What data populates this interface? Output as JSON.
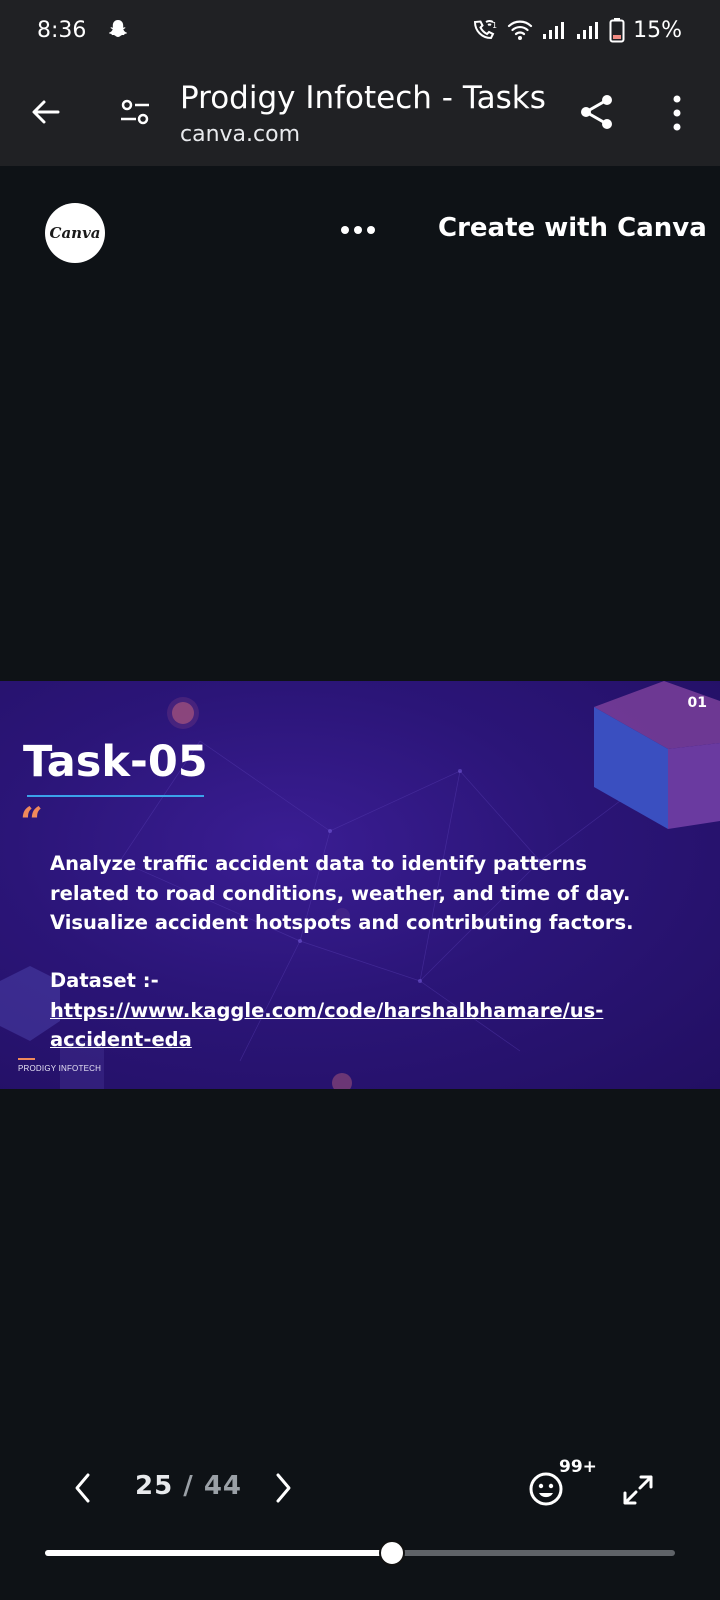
{
  "status_bar": {
    "time": "8:36",
    "battery": "15%",
    "icons": [
      "snapchat-icon",
      "wifi-call-icon",
      "wifi-icon",
      "signal-icon",
      "signal-icon",
      "battery-icon"
    ]
  },
  "app_bar": {
    "title": "Prodigy Infotech - Tasks",
    "url": "canva.com",
    "icons": [
      "back-arrow-icon",
      "tune-icon",
      "share-icon",
      "more-vert-icon"
    ]
  },
  "canva_header": {
    "logo_text": "Canva",
    "create_label": "Create with Canva"
  },
  "slide": {
    "number": "01",
    "title": "Task-05",
    "quote_mark": "“",
    "body": "Analyze traffic accident data to identify patterns related to road conditions, weather, and time of day. Visualize accident hotspots and contributing factors.",
    "dataset_label": "Dataset :-",
    "dataset_link": "https://www.kaggle.com/code/harshalbhamare/us-accident-eda",
    "brand": "PRODIGY INFOTECH",
    "colors": {
      "accent": "#f08a5b",
      "underline": "#3ba2ea",
      "background": "#2b1578"
    }
  },
  "navigation": {
    "current_page": "25",
    "separator": "/",
    "total_pages": "44",
    "reactions_badge": "99+",
    "progress_fraction": 0.55
  }
}
